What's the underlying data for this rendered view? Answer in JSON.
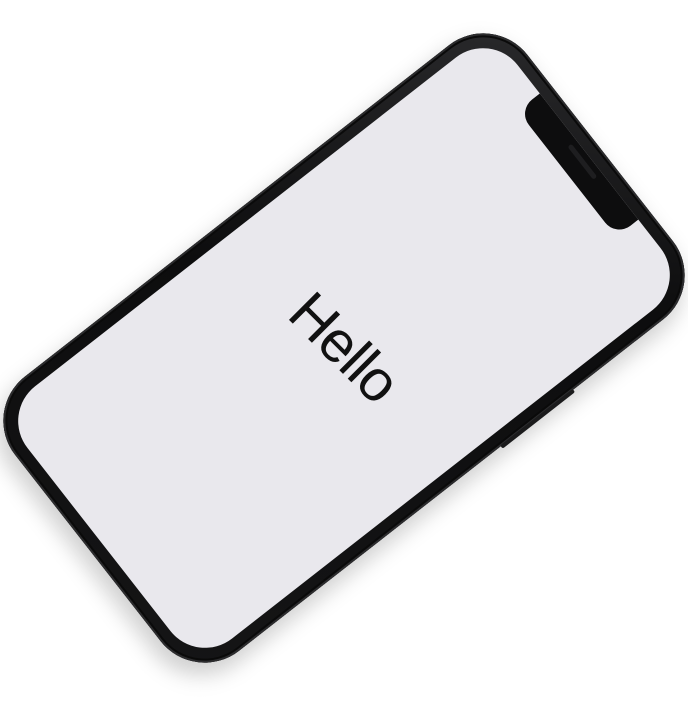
{
  "screen": {
    "greeting": "Hello"
  },
  "colors": {
    "background": "#ffffff",
    "phone_body": "#0d0d0e",
    "screen": "#e9e8ed",
    "text": "#111111"
  }
}
